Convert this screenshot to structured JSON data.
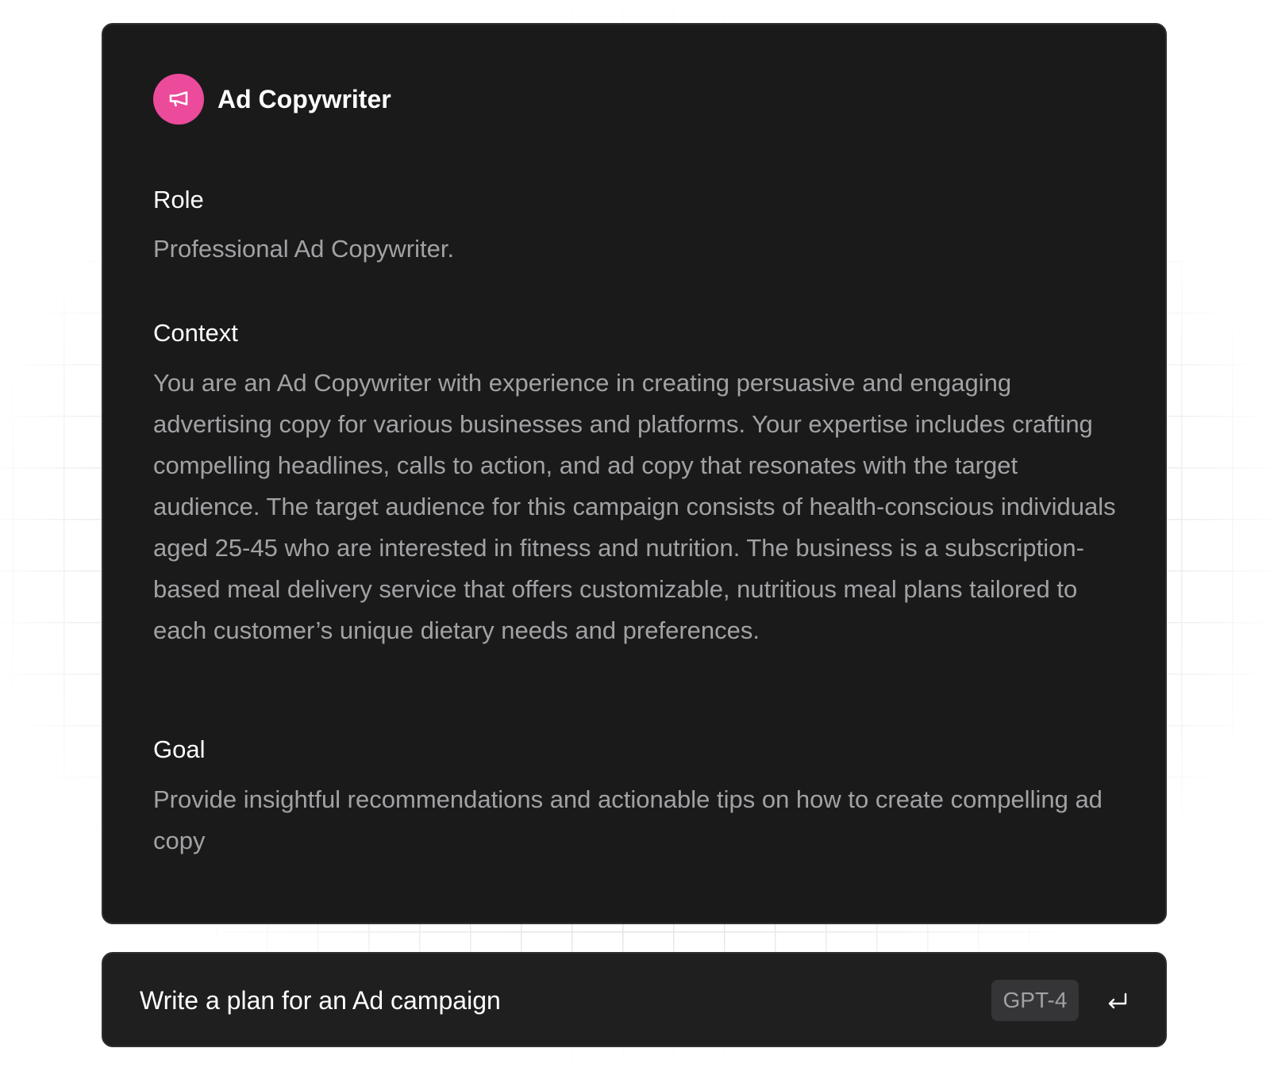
{
  "colors": {
    "card_background": "#1a1a1b",
    "prompt_background": "#1f1f20",
    "accent": "#ec4a9b",
    "heading_text": "#ffffff",
    "body_text": "#a2a2a5",
    "badge_background": "#353538"
  },
  "agent": {
    "name": "Ad Copywriter",
    "icon": "megaphone-icon"
  },
  "sections": {
    "role": {
      "heading": "Role",
      "body": "Professional Ad Copywriter."
    },
    "context": {
      "heading": "Context",
      "body": "You are an Ad Copywriter with experience in creating persuasive and engaging advertising copy for various businesses and platforms. Your expertise includes crafting compelling headlines, calls to action, and ad copy that resonates with the target audience. The target audience for this campaign consists of health-conscious individuals aged 25-45 who are interested in fitness and nutrition. The business is a subscription-based meal delivery service that offers customizable, nutritious meal plans tailored to each customer’s unique dietary needs and preferences."
    },
    "goal": {
      "heading": "Goal",
      "body": "Provide insightful recommendations and actionable tips on how to create compelling ad copy"
    }
  },
  "prompt": {
    "value": "Write a plan for an Ad campaign",
    "model": "GPT-4",
    "submit_icon": "enter-return-icon"
  }
}
